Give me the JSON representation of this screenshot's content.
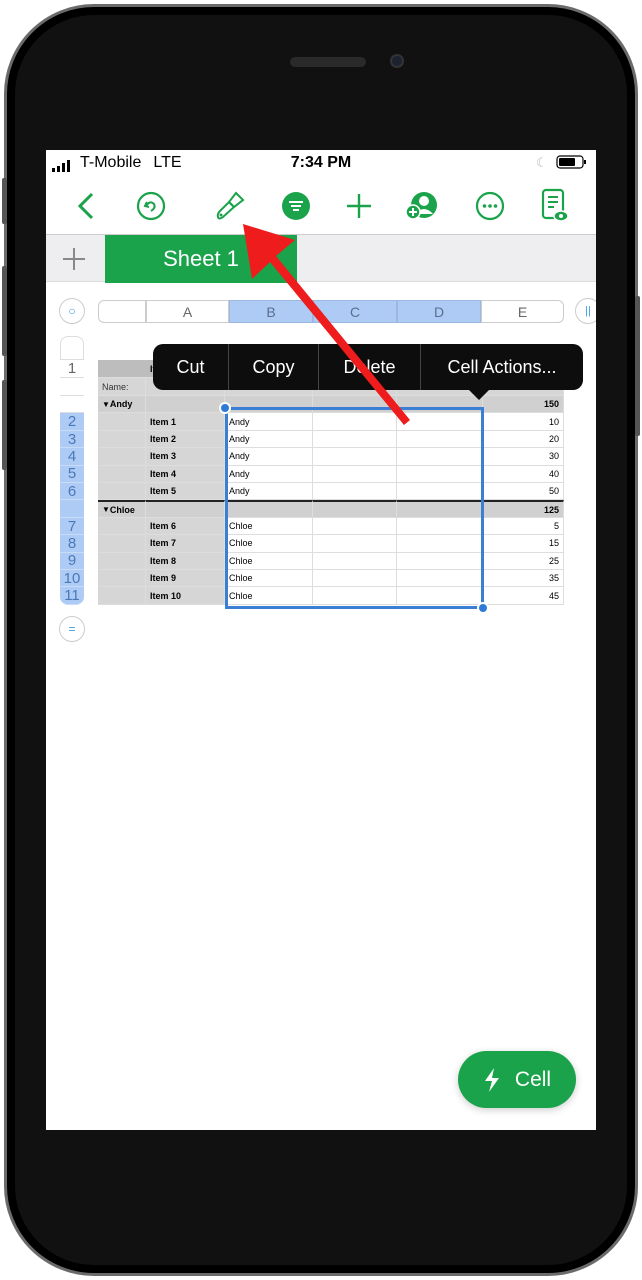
{
  "status_bar": {
    "carrier": "T-Mobile",
    "network": "LTE",
    "time": "7:34 PM"
  },
  "toolbar": {
    "icons": [
      "back-chevron-icon",
      "undo-icon",
      "paintbrush-icon",
      "filter-icon",
      "plus-icon",
      "collaborate-icon",
      "more-icon",
      "reader-view-icon"
    ]
  },
  "sheet_tabs": {
    "active": "Sheet 1"
  },
  "column_headers": [
    "A",
    "B",
    "C",
    "D",
    "E"
  ],
  "selected_columns": [
    "B",
    "C",
    "D"
  ],
  "row_numbers": [
    "1",
    "2",
    "3",
    "4",
    "5",
    "6",
    "7",
    "8",
    "9",
    "10",
    "11"
  ],
  "context_menu": {
    "items": [
      "Cut",
      "Copy",
      "Delete",
      "Cell Actions..."
    ]
  },
  "table": {
    "header_label": "Item",
    "name_label": "Name:",
    "groups": [
      {
        "name": "Andy",
        "total": "150",
        "rows": [
          [
            "Item 1",
            "Andy",
            "10"
          ],
          [
            "Item 2",
            "Andy",
            "20"
          ],
          [
            "Item 3",
            "Andy",
            "30"
          ],
          [
            "Item 4",
            "Andy",
            "40"
          ],
          [
            "Item 5",
            "Andy",
            "50"
          ]
        ]
      },
      {
        "name": "Chloe",
        "total": "125",
        "rows": [
          [
            "Item 6",
            "Chloe",
            "5"
          ],
          [
            "Item 7",
            "Chloe",
            "15"
          ],
          [
            "Item 8",
            "Chloe",
            "25"
          ],
          [
            "Item 9",
            "Chloe",
            "35"
          ],
          [
            "Item 10",
            "Chloe",
            "45"
          ]
        ]
      }
    ]
  },
  "fab": {
    "label": "Cell",
    "icon": "lightning-icon"
  },
  "colors": {
    "accent": "#1aa34a",
    "selection": "#3b7fd4",
    "arrow": "#ee1c1c"
  }
}
